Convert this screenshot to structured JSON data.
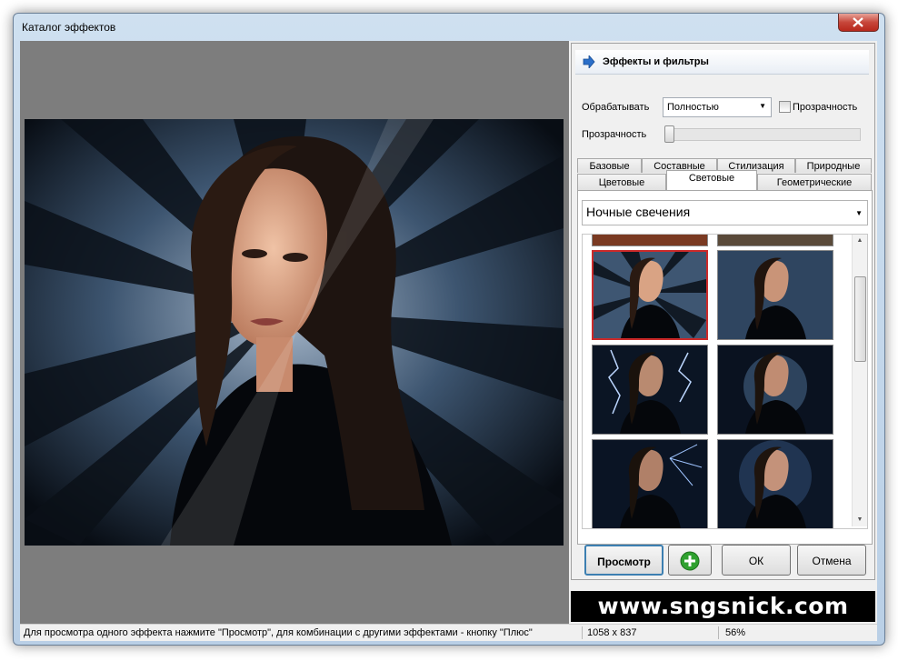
{
  "window": {
    "title": "Каталог эффектов"
  },
  "effects_panel": {
    "header_title": "Эффекты и фильтры",
    "process_label": "Обрабатывать",
    "process_value": "Полностью",
    "transparency_checkbox_label": "Прозрачность",
    "transparency_checked": false,
    "transparency_slider_label": "Прозрачность",
    "transparency_level": 0
  },
  "tabs": {
    "row1": [
      "Базовые",
      "Составные",
      "Стилизация",
      "Природные"
    ],
    "row2": [
      "Цветовые",
      "Световые",
      "Геометрические"
    ],
    "active": "Световые"
  },
  "effect_list": {
    "selected_effect": "Ночные свечения",
    "selected_thumb_index": 0
  },
  "buttons": {
    "preview": "Просмотр",
    "plus_icon": "plus-icon",
    "ok": "ОК",
    "cancel": "Отмена"
  },
  "watermark": "www.sngsnick.com",
  "status": {
    "hint": "Для просмотра одного эффекта нажмите \"Просмотр\", для комбинации с другими эффектами - кнопку \"Плюс\"",
    "dimensions": "1058 x 837",
    "zoom": "56%"
  },
  "colors": {
    "selection_border": "#cc2a2a",
    "preview_background": "#7d7d7d",
    "plus_green": "#2fa12f"
  }
}
